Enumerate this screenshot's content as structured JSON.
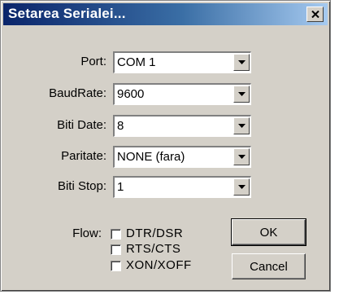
{
  "window": {
    "title": "Setarea Serialei..."
  },
  "fields": [
    {
      "label": "Port:",
      "value": "COM 1"
    },
    {
      "label": "BaudRate:",
      "value": "9600"
    },
    {
      "label": "Biti Date:",
      "value": "8"
    },
    {
      "label": "Paritate:",
      "value": "NONE (fara)"
    },
    {
      "label": "Biti Stop:",
      "value": "1"
    }
  ],
  "flow": {
    "label": "Flow:",
    "options": [
      {
        "label": "DTR/DSR",
        "checked": false
      },
      {
        "label": "RTS/CTS",
        "checked": false
      },
      {
        "label": "XON/XOFF",
        "checked": false
      }
    ]
  },
  "buttons": {
    "ok": "OK",
    "cancel": "Cancel"
  },
  "icons": {
    "close": "close-icon",
    "dropdown": "chevron-down-icon"
  }
}
